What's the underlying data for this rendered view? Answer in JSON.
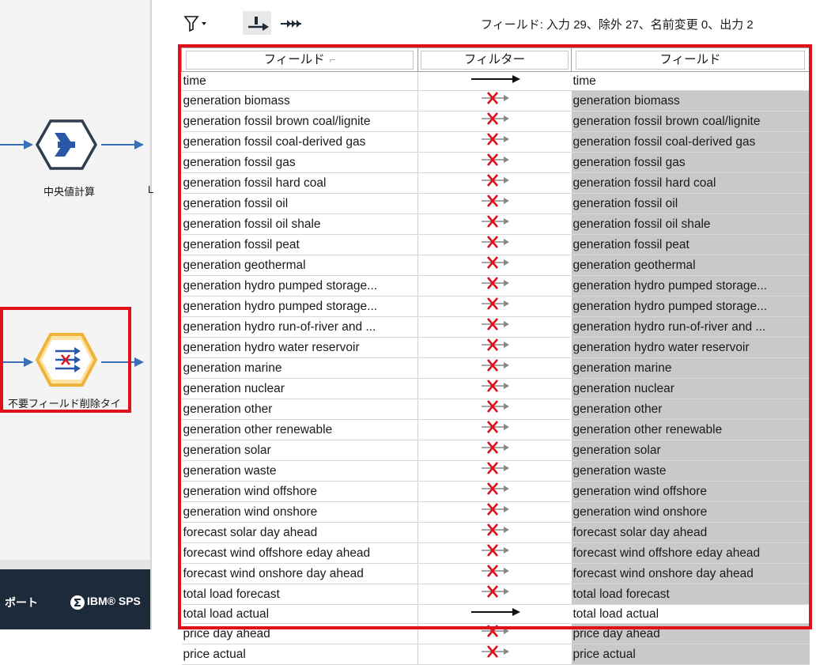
{
  "canvas": {
    "node1_label": "中央値計算",
    "node2_label": "不要フィールド削除タイ",
    "partial_char": "L",
    "statusbar": {
      "left_text": "ポート",
      "brand_text": "IBM® SPS"
    }
  },
  "toolbar": {
    "filter_icon": "filter-icon",
    "summary": "フィールド: 入力 29、除外 27、名前変更 0、出力 2"
  },
  "table": {
    "headers": {
      "input": "フィールド",
      "filter": "フィルター",
      "output": "フィールド"
    },
    "rows": [
      {
        "field": "time",
        "on": true
      },
      {
        "field": "generation biomass",
        "on": false
      },
      {
        "field": "generation fossil brown coal/lignite",
        "on": false
      },
      {
        "field": "generation fossil coal-derived gas",
        "on": false
      },
      {
        "field": "generation fossil gas",
        "on": false
      },
      {
        "field": "generation fossil hard coal",
        "on": false
      },
      {
        "field": "generation fossil oil",
        "on": false
      },
      {
        "field": "generation fossil oil shale",
        "on": false
      },
      {
        "field": "generation fossil peat",
        "on": false
      },
      {
        "field": "generation geothermal",
        "on": false
      },
      {
        "field": "generation hydro pumped storage...",
        "on": false
      },
      {
        "field": "generation hydro pumped storage...",
        "on": false
      },
      {
        "field": "generation hydro run-of-river and ...",
        "on": false
      },
      {
        "field": "generation hydro water reservoir",
        "on": false
      },
      {
        "field": "generation marine",
        "on": false
      },
      {
        "field": "generation nuclear",
        "on": false
      },
      {
        "field": "generation other",
        "on": false
      },
      {
        "field": "generation other renewable",
        "on": false
      },
      {
        "field": "generation solar",
        "on": false
      },
      {
        "field": "generation waste",
        "on": false
      },
      {
        "field": "generation wind offshore",
        "on": false
      },
      {
        "field": "generation wind onshore",
        "on": false
      },
      {
        "field": "forecast solar day ahead",
        "on": false
      },
      {
        "field": "forecast wind offshore eday ahead",
        "on": false
      },
      {
        "field": "forecast wind onshore day ahead",
        "on": false
      },
      {
        "field": "total load forecast",
        "on": false
      },
      {
        "field": "total load actual",
        "on": true
      },
      {
        "field": "price day ahead",
        "on": false
      },
      {
        "field": "price actual",
        "on": false
      }
    ]
  },
  "colors": {
    "highlight": "#e0111b",
    "link": "#3a6fb5",
    "excluded_bg": "#c9c9c9"
  }
}
